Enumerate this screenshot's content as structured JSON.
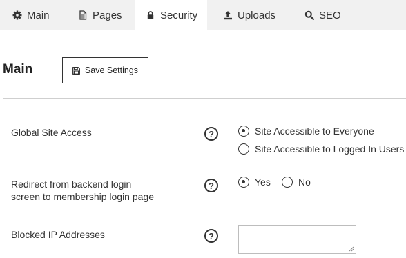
{
  "tabs": [
    {
      "label": "Main",
      "icon": "gear-icon"
    },
    {
      "label": "Pages",
      "icon": "document-icon"
    },
    {
      "label": "Security",
      "icon": "lock-icon"
    },
    {
      "label": "Uploads",
      "icon": "upload-icon"
    },
    {
      "label": "SEO",
      "icon": "search-icon"
    }
  ],
  "active_tab": "Security",
  "section": {
    "title": "Main",
    "save_label": "Save Settings"
  },
  "settings": {
    "global_access": {
      "label": "Global Site Access",
      "options": [
        "Site Accessible to Everyone",
        "Site Accessible to Logged In Users"
      ],
      "selected": "Site Accessible to Everyone"
    },
    "redirect": {
      "label_line1": "Redirect from backend login",
      "label_line2": "screen to membership login page",
      "options": [
        "Yes",
        "No"
      ],
      "selected": "Yes"
    },
    "blocked_ips": {
      "label": "Blocked IP Addresses",
      "value": ""
    }
  },
  "help_text": "?",
  "colors": {
    "tab_bar": "#f1f1f1",
    "text": "#333333",
    "divider": "#cfcfcf"
  }
}
